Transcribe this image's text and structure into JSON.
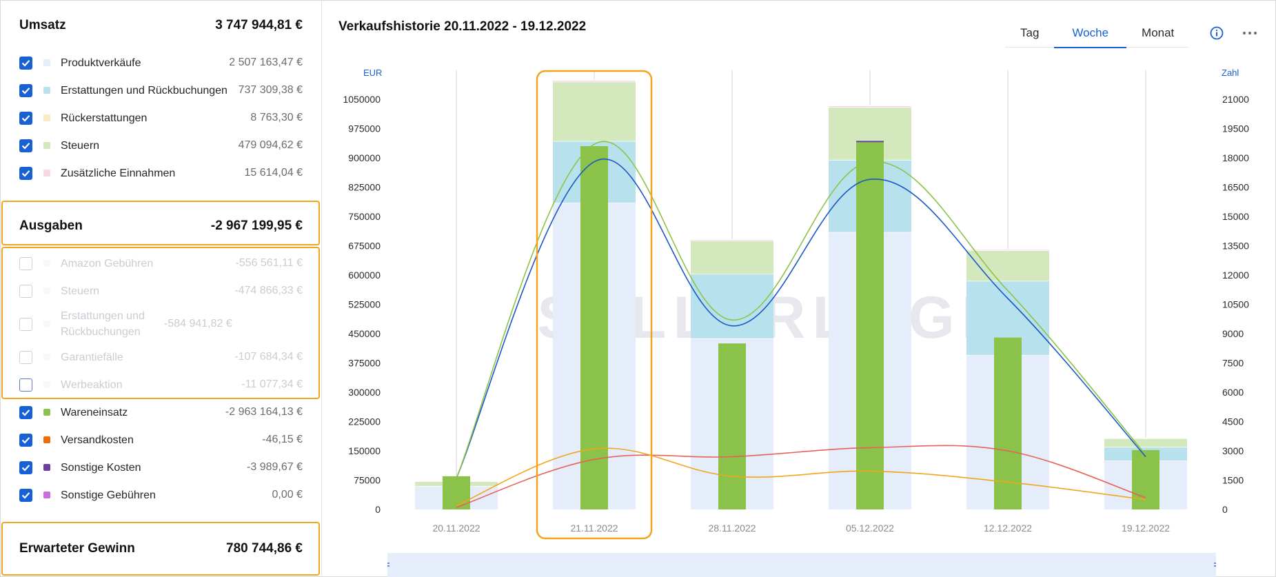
{
  "umsatz": {
    "title": "Umsatz",
    "total": "3 747 944,81 €",
    "items": [
      {
        "label": "Produktverkäufe",
        "value": "2 507 163,47 €",
        "color": "#e5ecfa",
        "checked": true
      },
      {
        "label": "Erstattungen und Rückbuchungen",
        "value": "737 309,38 €",
        "color": "#b7e1ec",
        "checked": true
      },
      {
        "label": "Rückerstattungen",
        "value": "8 763,30 €",
        "color": "#fbe9c6",
        "checked": true
      },
      {
        "label": "Steuern",
        "value": "479 094,62 €",
        "color": "#d3e8bc",
        "checked": true
      },
      {
        "label": "Zusätzliche Einnahmen",
        "value": "15 614,04 €",
        "color": "#f9d7e2",
        "checked": true
      }
    ]
  },
  "ausgaben": {
    "title": "Ausgaben",
    "total": "-2 967 199,95 €",
    "items": [
      {
        "label": "Amazon Gebühren",
        "value": "-556 561,11 €",
        "color": "#e9ecf1",
        "checked": false
      },
      {
        "label": "Steuern",
        "value": "-474 866,33 €",
        "color": "#e9ecf1",
        "checked": false
      },
      {
        "label": "Erstattungen und Rückbuchungen",
        "value": "-584 941,82 €",
        "color": "#e9ecf1",
        "checked": false
      },
      {
        "label": "Garantiefälle",
        "value": "-107 684,34 €",
        "color": "#e9ecf1",
        "checked": false
      },
      {
        "label": "Werbeaktion",
        "value": "-11 077,34 €",
        "color": "#e9ecf1",
        "checked": false
      },
      {
        "label": "Wareneinsatz",
        "value": "-2 963 164,13 €",
        "color": "#8bc34a",
        "checked": true
      },
      {
        "label": "Versandkosten",
        "value": "-46,15 €",
        "color": "#ef6c00",
        "checked": true
      },
      {
        "label": "Sonstige Kosten",
        "value": "-3 989,67 €",
        "color": "#6a3fa0",
        "checked": true
      },
      {
        "label": "Sonstige Gebühren",
        "value": "0,00 €",
        "color": "#c76fe0",
        "checked": true
      }
    ]
  },
  "gewinn": {
    "title": "Erwarteter Gewinn",
    "total": "780 744,86 €"
  },
  "header": {
    "title": "Verkaufshistorie 20.11.2022 - 19.12.2022",
    "tabs": [
      "Tag",
      "Woche",
      "Monat"
    ],
    "active_tab": "Woche",
    "watermark": "SELLERLOGIC"
  },
  "chart_data": {
    "type": "bar",
    "left_axis_label": "EUR",
    "right_axis_label": "Zahl",
    "categories": [
      "20.11.2022",
      "21.11.2022",
      "28.11.2022",
      "05.12.2022",
      "12.12.2022",
      "19.12.2022"
    ],
    "left_ylim": [
      0,
      1050000
    ],
    "left_ticks": [
      0,
      75000,
      150000,
      225000,
      300000,
      375000,
      450000,
      525000,
      600000,
      675000,
      750000,
      825000,
      900000,
      975000,
      1050000
    ],
    "right_ylim": [
      0,
      21000
    ],
    "right_ticks": [
      0,
      1500,
      3000,
      4500,
      6000,
      7500,
      9000,
      10500,
      12000,
      13500,
      15000,
      16500,
      18000,
      19500,
      21000
    ],
    "stacked_series": [
      {
        "name": "Produktverkäufe",
        "color": "#e5ecfa",
        "values": [
          60000,
          785000,
          438000,
          710000,
          395000,
          125000
        ]
      },
      {
        "name": "Erstattungen und Rückbuchungen",
        "color": "#b7e1ec",
        "values": [
          0,
          158000,
          165000,
          185000,
          190000,
          35000
        ]
      },
      {
        "name": "Steuern",
        "color": "#d3e8bc",
        "values": [
          12000,
          152000,
          85000,
          135000,
          78000,
          22000
        ]
      },
      {
        "name": "Zusätzliche Einnahmen",
        "color": "#f9d7e2",
        "values": [
          1000,
          4000,
          3000,
          4000,
          3000,
          1000
        ]
      }
    ],
    "cost_bars": {
      "name": "Wareneinsatz",
      "color": "#8bc34a",
      "values": [
        85000,
        930000,
        425000,
        940000,
        440000,
        152000
      ]
    },
    "lines": [
      {
        "name": "Blau",
        "color": "#1a56c8",
        "axis": "left",
        "values": [
          80000,
          890000,
          470000,
          845000,
          540000,
          135000
        ]
      },
      {
        "name": "Grün",
        "color": "#8bc34a",
        "axis": "left",
        "values": [
          80000,
          935000,
          485000,
          890000,
          560000,
          140000
        ]
      },
      {
        "name": "Rot",
        "color": "#e8605a",
        "axis": "left",
        "values": [
          5000,
          128000,
          135000,
          158000,
          150000,
          30000
        ]
      },
      {
        "name": "Orange",
        "color": "#f2a51a",
        "axis": "left",
        "values": [
          10000,
          155000,
          85000,
          98000,
          70000,
          25000
        ]
      }
    ],
    "highlight_category": "21.11.2022"
  }
}
